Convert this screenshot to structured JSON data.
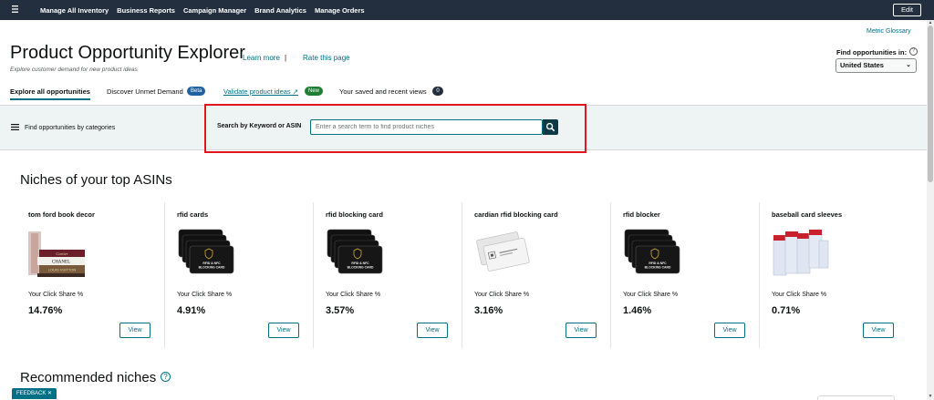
{
  "topnav": {
    "menu_icon": "hamburger-icon",
    "items": [
      "Manage All Inventory",
      "Business Reports",
      "Campaign Manager",
      "Brand Analytics",
      "Manage Orders"
    ],
    "edit_label": "Edit"
  },
  "header": {
    "metric_glossary": "Metric Glossary",
    "title": "Product Opportunity Explorer",
    "learn_more": "Learn more",
    "separator": "|",
    "rate_page": "Rate this page",
    "subtitle": "Explore customer demand for new product ideas",
    "find_label": "Find opportunities in:",
    "help_icon": "help-circle-icon",
    "country": "United States"
  },
  "tabs": {
    "explore": "Explore all opportunities",
    "unmet": "Discover Unmet Demand",
    "unmet_badge": "Beta",
    "validate": "Validate product ideas ↗",
    "validate_badge": "New",
    "saved": "Your saved and recent views",
    "saved_count": "0"
  },
  "search": {
    "categories_label": "Find opportunities by categories",
    "label": "Search by Keyword or ASIN",
    "placeholder": "Enter a search term to find product niches",
    "value": ""
  },
  "top_asins": {
    "title": "Niches of your top ASINs",
    "metric_label": "Your Click Share %",
    "view_label": "View",
    "cards": [
      {
        "title": "tom ford book decor",
        "value": "14.76%",
        "image": "book-stack-image"
      },
      {
        "title": "rfid cards",
        "value": "4.91%",
        "image": "rfid-card-image"
      },
      {
        "title": "rfid blocking card",
        "value": "3.57%",
        "image": "rfid-card-image"
      },
      {
        "title": "cardian rfid blocking card",
        "value": "3.16%",
        "image": "white-card-image"
      },
      {
        "title": "rfid blocker",
        "value": "1.46%",
        "image": "rfid-card-image"
      },
      {
        "title": "baseball card sleeves",
        "value": "0.71%",
        "image": "card-sleeves-image"
      }
    ]
  },
  "recommended": {
    "title": "Recommended niches"
  },
  "feedback": "FEEDBACK ✕",
  "colors": {
    "nav_bg": "#232f3e",
    "link": "#007185",
    "highlight": "#e3141b",
    "search_btn": "#0d3a44",
    "band_bg": "#eef3f3"
  }
}
